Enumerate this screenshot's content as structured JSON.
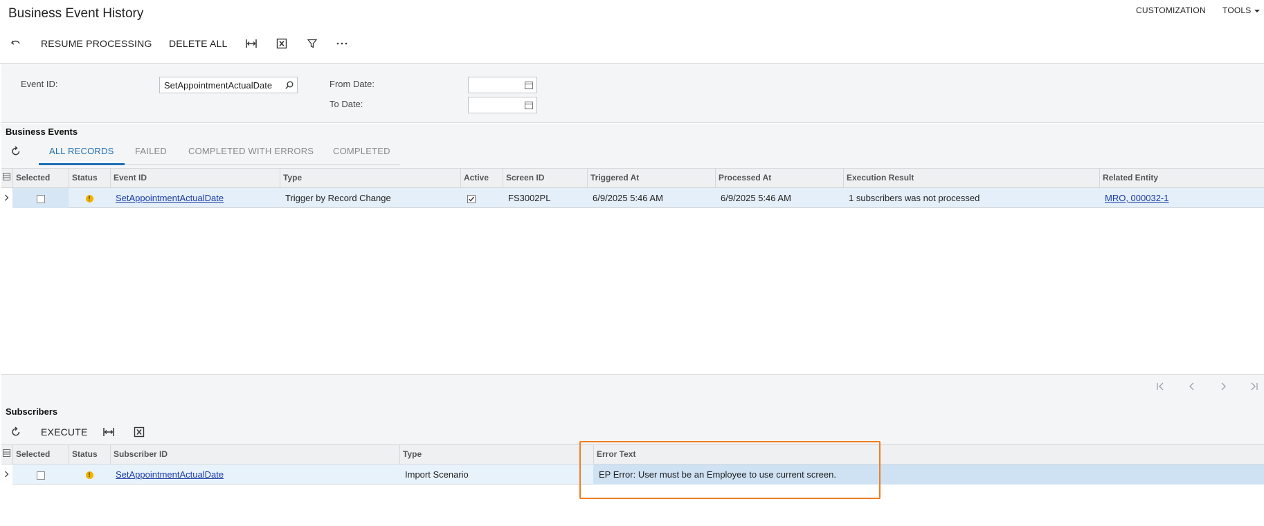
{
  "header": {
    "title": "Business Event History",
    "customization": "CUSTOMIZATION",
    "tools": "TOOLS"
  },
  "toolbar": {
    "resume_processing": "RESUME PROCESSING",
    "delete_all": "DELETE ALL"
  },
  "filter": {
    "event_id_label": "Event ID:",
    "event_id_value": "SetAppointmentActualDate",
    "from_date_label": "From Date:",
    "from_date_value": "",
    "to_date_label": "To Date:",
    "to_date_value": ""
  },
  "business_events": {
    "title": "Business Events",
    "tabs": [
      "ALL RECORDS",
      "FAILED",
      "COMPLETED WITH ERRORS",
      "COMPLETED"
    ],
    "active_tab": "ALL RECORDS",
    "columns": [
      "Selected",
      "Status",
      "Event ID",
      "Type",
      "Active",
      "Screen ID",
      "Triggered At",
      "Processed At",
      "Execution Result",
      "Related Entity"
    ],
    "rows": [
      {
        "event_id": "SetAppointmentActualDate",
        "type": "Trigger by Record Change",
        "screen_id": "FS3002PL",
        "triggered_at": "6/9/2025 5:46 AM",
        "processed_at": "6/9/2025 5:46 AM",
        "execution_result": "1 subscribers was not processed",
        "related_entity": "MRO, 000032-1"
      }
    ]
  },
  "subscribers": {
    "title": "Subscribers",
    "execute": "EXECUTE",
    "columns": [
      "Selected",
      "Status",
      "Subscriber ID",
      "Type",
      "Error Text"
    ],
    "rows": [
      {
        "subscriber_id": "SetAppointmentActualDate",
        "type": "Import Scenario",
        "error_text": "EP Error: User must be an Employee to use current screen."
      }
    ]
  },
  "colors": {
    "accent": "#1f6fb5",
    "highlight": "#ef7d22",
    "warning": "#f0b400"
  }
}
